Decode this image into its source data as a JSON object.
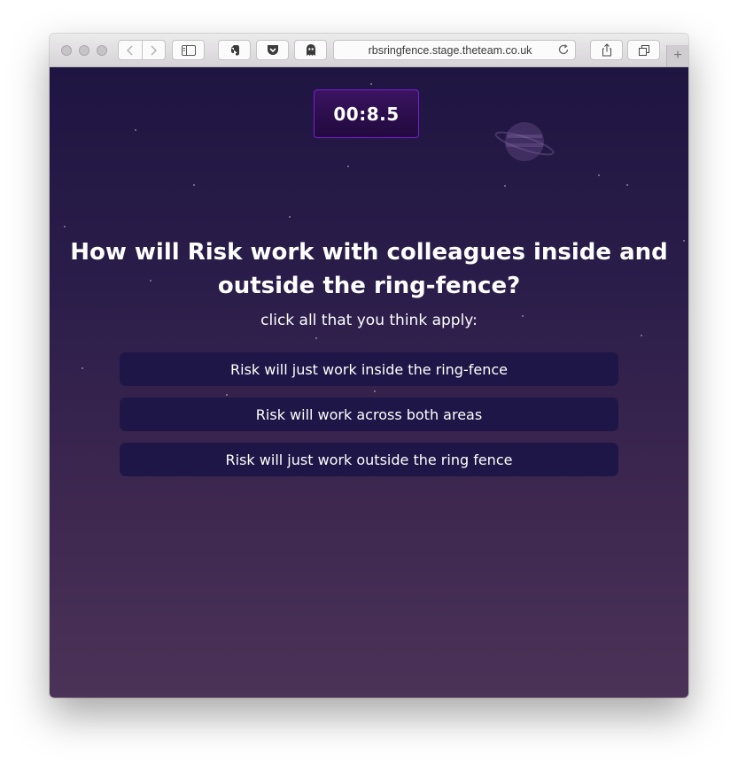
{
  "browser": {
    "url": "rbsringfence.stage.theteam.co.uk",
    "new_tab_label": "+"
  },
  "quiz": {
    "timer": "00:8.5",
    "question": "How will Risk work with colleagues inside and outside the ring-fence?",
    "instruction": "click all that you think apply:",
    "options": [
      "Risk will just work inside the ring-fence",
      "Risk will work across both areas",
      "Risk will just work outside the ring fence"
    ]
  },
  "colors": {
    "background_top": "#1f1542",
    "background_bottom": "#4b3257",
    "option_background": "#1e1646",
    "timer_border": "#7a1fd0"
  }
}
